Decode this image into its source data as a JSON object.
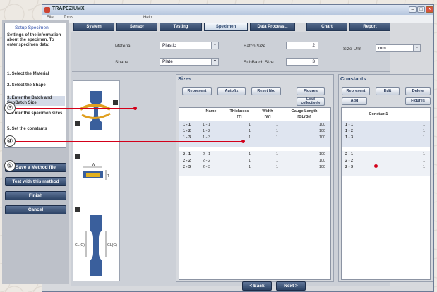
{
  "window": {
    "title": "TRAPEZIUMX"
  },
  "menubar": {
    "items": [
      "File",
      "Tools",
      "Help"
    ]
  },
  "tabs": [
    {
      "label": "System",
      "active": false
    },
    {
      "label": "Sensor",
      "active": false
    },
    {
      "label": "Testing",
      "active": false
    },
    {
      "label": "Specimen",
      "active": true
    },
    {
      "label": "Data Process...",
      "active": false
    },
    {
      "label": "Chart",
      "active": false
    },
    {
      "label": "Report",
      "active": false
    }
  ],
  "left_panel": {
    "link": "Setup Specimen",
    "description": "Settings of the information about the specimen. To enter specimen data:",
    "steps": [
      "1. Select the Material",
      "2. Select the Shape",
      "3. Enter the Batch and SubBatch Size",
      "4. Enter the specimen sizes",
      "5. Set the constants"
    ],
    "buttons": [
      "Save a Method file",
      "Test with this method",
      "Finish",
      "Cancel"
    ]
  },
  "form": {
    "material_label": "Material",
    "material_value": "Plastic",
    "shape_label": "Shape",
    "shape_value": "Plate",
    "batch_label": "Batch Size",
    "batch_value": "2",
    "subbatch_label": "SubBatch Size",
    "subbatch_value": "3",
    "sizeunit_label": "Size Unit",
    "sizeunit_value": "mm"
  },
  "sizes": {
    "title": "Sizes:",
    "buttons": [
      "Represent",
      "Autofix",
      "Reset No.",
      "Figures"
    ],
    "load_button": "Load collectively",
    "columns": [
      {
        "name": "Name",
        "unit": ""
      },
      {
        "name": "Thickness",
        "unit": "[T]"
      },
      {
        "name": "Width",
        "unit": "[W]"
      },
      {
        "name": "Gauge Length",
        "unit": "[GL(G)]"
      }
    ],
    "rows": [
      {
        "id": "1 - 1",
        "name": "1 - 1",
        "thickness": "1",
        "width": "1",
        "gauge": "100"
      },
      {
        "id": "1 - 2",
        "name": "1 - 2",
        "thickness": "1",
        "width": "1",
        "gauge": "100"
      },
      {
        "id": "1 - 3",
        "name": "1 - 3",
        "thickness": "1",
        "width": "1",
        "gauge": "100"
      },
      {
        "id": "2 - 1",
        "name": "2 - 1",
        "thickness": "1",
        "width": "1",
        "gauge": "100"
      },
      {
        "id": "2 - 2",
        "name": "2 - 2",
        "thickness": "1",
        "width": "1",
        "gauge": "100"
      },
      {
        "id": "2 - 3",
        "name": "2 - 3",
        "thickness": "1",
        "width": "1",
        "gauge": "100"
      }
    ]
  },
  "constants": {
    "title": "Constants:",
    "buttons": [
      "Represent",
      "Edit",
      "Delete"
    ],
    "add_button": "Add",
    "figures_button": "Figures",
    "column": "Constant1",
    "rows": [
      {
        "id": "1 - 1",
        "value": "1"
      },
      {
        "id": "1 - 2",
        "value": "1"
      },
      {
        "id": "1 - 3",
        "value": "1"
      },
      {
        "id": "2 - 1",
        "value": "1"
      },
      {
        "id": "2 - 2",
        "value": "1"
      },
      {
        "id": "2 - 3",
        "value": "1"
      }
    ]
  },
  "figure_labels": {
    "w": "W",
    "t": "T",
    "gl1": "GL(G)",
    "gl2": "GL(G)"
  },
  "nav": {
    "back": "< Back",
    "next": "Next >"
  },
  "callouts": [
    "③",
    "④",
    "⑤"
  ],
  "colors": {
    "accent_blue": "#2e4466",
    "callout_line": "#d3001a",
    "specimen": "#3a5f9c"
  }
}
